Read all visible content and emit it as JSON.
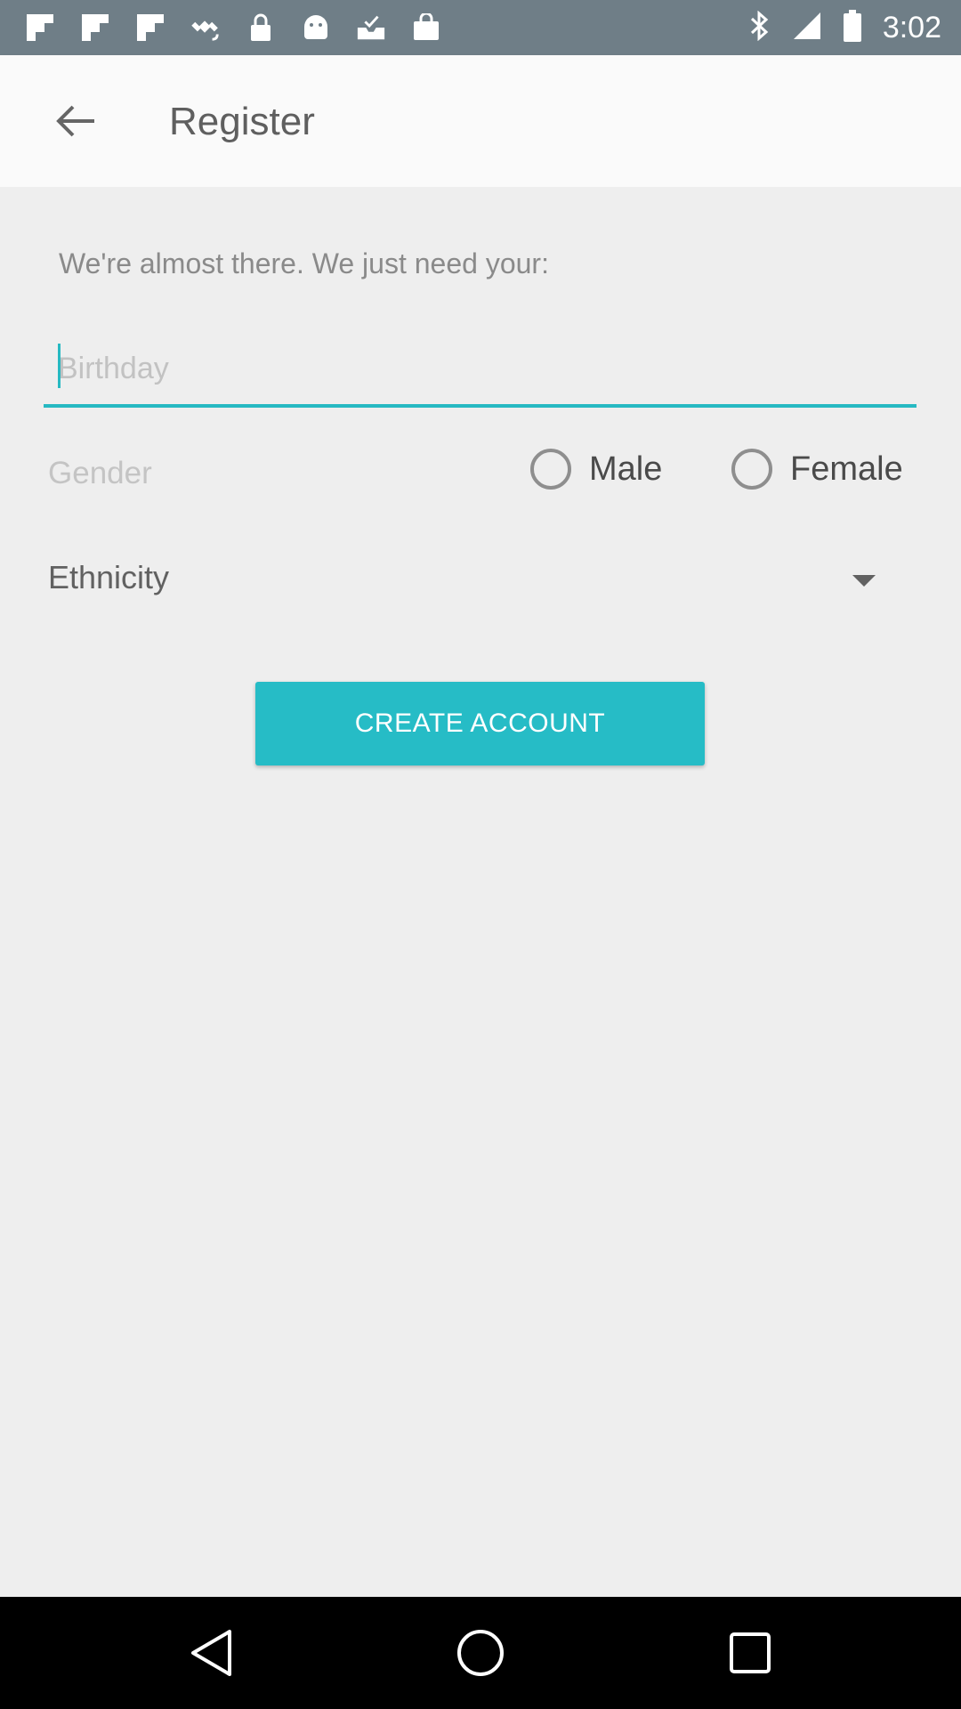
{
  "status_bar": {
    "time": "3:02",
    "left_icons": [
      "flipboard-icon",
      "flipboard-icon",
      "flipboard-icon",
      "fake-gps-icon",
      "lock-icon",
      "android-icon",
      "inbox-check-icon",
      "shopping-bag-icon"
    ],
    "right_icons": [
      "bluetooth-icon",
      "signal-icon",
      "battery-icon"
    ]
  },
  "app_bar": {
    "title": "Register",
    "back_icon": "arrow-left-icon"
  },
  "form": {
    "intro": "We're almost there. We just need your:",
    "birthday_placeholder": "Birthday",
    "gender_label": "Gender",
    "gender_options": [
      "Male",
      "Female"
    ],
    "ethnicity_value": "Ethnicity",
    "submit_label": "CREATE ACCOUNT"
  },
  "nav_bar": {
    "icons": [
      "back-triangle-icon",
      "home-circle-icon",
      "recents-square-icon"
    ]
  },
  "colors": {
    "accent": "#26bcc6",
    "status_bar": "#6f7e87",
    "background": "#eeeeee"
  }
}
